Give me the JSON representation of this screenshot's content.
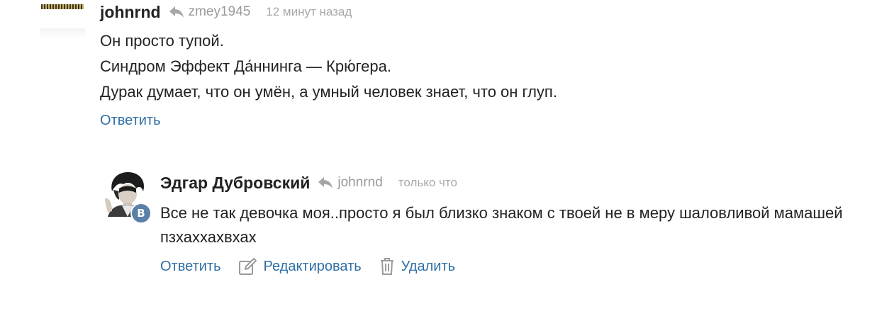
{
  "comments": [
    {
      "author": "johnrnd",
      "reply_to": "zmey1945",
      "time": "12 минут назад",
      "lines": [
        "Он просто тупой.",
        "Синдром Эффект Да́ннинга — Крю́гера.",
        "Дурак думает, что он умён, а умный человек знает, что он глуп."
      ],
      "actions": {
        "reply": "Ответить"
      }
    },
    {
      "author": "Эдгар Дубровский",
      "reply_to": "johnrnd",
      "time": "только что",
      "text": "Все не так девочка моя..просто я был близко знаком с твоей не в меру шаловливой мамашей пзхаххахвхах",
      "badge": "B",
      "actions": {
        "reply": "Ответить",
        "edit": "Редактировать",
        "delete": "Удалить"
      }
    }
  ],
  "icons": {
    "reply_arrow": "reply-arrow-icon",
    "edit": "pencil-square-icon",
    "delete": "trash-icon"
  },
  "colors": {
    "link": "#2f6ea6",
    "meta_gray": "#9a9a9a",
    "badge": "#5a7fa8"
  }
}
